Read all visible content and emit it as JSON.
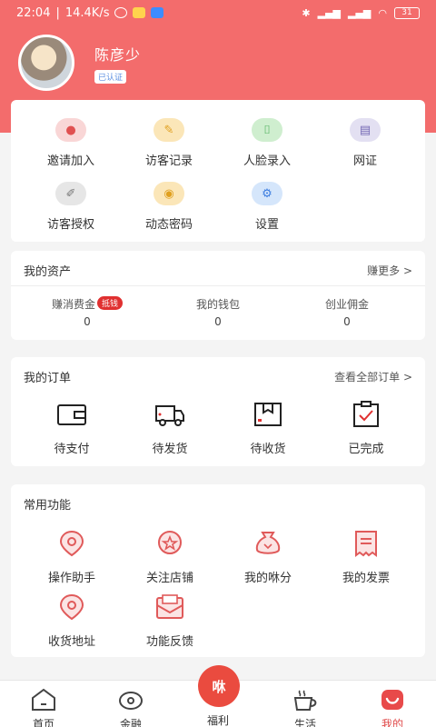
{
  "status": {
    "time": "22:04",
    "speed": "14.4K/s",
    "battery": "31"
  },
  "profile": {
    "name": "陈彦少",
    "verified": "已认证"
  },
  "grid": [
    {
      "label": "邀请加入",
      "icon": "user-invite-icon",
      "color": "#f9d6d6"
    },
    {
      "label": "访客记录",
      "icon": "visitor-record-icon",
      "color": "#fbe6b8"
    },
    {
      "label": "人脸录入",
      "icon": "face-scan-icon",
      "color": "#cfeecf"
    },
    {
      "label": "网证",
      "icon": "id-card-icon",
      "color": "#e3e0f2"
    },
    {
      "label": "访客授权",
      "icon": "pen-icon",
      "color": "#e6e6e6"
    },
    {
      "label": "动态密码",
      "icon": "coins-icon",
      "color": "#fbe6b8"
    },
    {
      "label": "设置",
      "icon": "gear-icon",
      "color": "#d5e6fb"
    }
  ],
  "assets": {
    "title": "我的资产",
    "more": "赚更多 >",
    "items": [
      {
        "label": "赚消费金",
        "badge": "抵钱",
        "value": "0"
      },
      {
        "label": "我的钱包",
        "value": "0"
      },
      {
        "label": "创业佣金",
        "value": "0"
      }
    ]
  },
  "orders": {
    "title": "我的订单",
    "more": "查看全部订单 >",
    "items": [
      {
        "label": "待支付",
        "icon": "wallet-icon"
      },
      {
        "label": "待发货",
        "icon": "truck-icon"
      },
      {
        "label": "待收货",
        "icon": "box-icon"
      },
      {
        "label": "已完成",
        "icon": "clipboard-check-icon"
      }
    ]
  },
  "features": {
    "title": "常用功能",
    "items": [
      {
        "label": "操作助手",
        "icon": "location-pin-icon"
      },
      {
        "label": "关注店铺",
        "icon": "star-shop-icon"
      },
      {
        "label": "我的咻分",
        "icon": "money-bag-icon"
      },
      {
        "label": "我的发票",
        "icon": "receipt-icon"
      },
      {
        "label": "收货地址",
        "icon": "address-pin-icon"
      },
      {
        "label": "功能反馈",
        "icon": "feedback-mail-icon"
      }
    ]
  },
  "tabs": [
    {
      "label": "首页",
      "icon": "home-icon"
    },
    {
      "label": "金融",
      "icon": "finance-icon"
    },
    {
      "label": "福利",
      "icon": "welfare-icon"
    },
    {
      "label": "生活",
      "icon": "coffee-icon"
    },
    {
      "label": "我的",
      "icon": "profile-icon"
    }
  ],
  "center_button": "咻",
  "accent": "#f36c6c"
}
